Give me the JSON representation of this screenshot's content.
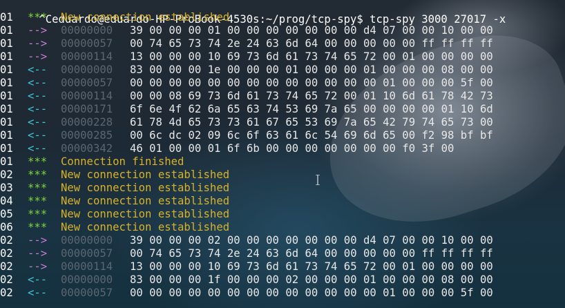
{
  "prompt": "^Ceduardo@eduardo-HP-ProBook-4530s:~/prog/tcp-spy$ tcp-spy 3000 27017 -x",
  "colors": {
    "info_marker": "#7fd63c",
    "outgoing_marker": "#c77bd0",
    "incoming_marker": "#3ec6d4",
    "status_message": "#d8b22a",
    "offset": "#5b6670",
    "hex": "#e8e8e8"
  },
  "lines": [
    {
      "cid": "01",
      "marker": "***",
      "kind": "info",
      "text": "New connection established"
    },
    {
      "cid": "01",
      "marker": "-->",
      "kind": "out",
      "offset": "00000000",
      "hex": "39 00 00 00 01 00 00 00 00 00 00 00 d4 07 00 00 10 00 00"
    },
    {
      "cid": "01",
      "marker": "-->",
      "kind": "out",
      "offset": "00000057",
      "hex": "00 74 65 73 74 2e 24 63 6d 64 00 00 00 00 00 ff ff ff ff"
    },
    {
      "cid": "01",
      "marker": "-->",
      "kind": "out",
      "offset": "00000114",
      "hex": "13 00 00 00 10 69 73 6d 61 73 74 65 72 00 01 00 00 00 00"
    },
    {
      "cid": "01",
      "marker": "<--",
      "kind": "in",
      "offset": "00000000",
      "hex": "83 00 00 00 1e 00 00 00 01 00 00 00 01 00 00 00 08 00 00"
    },
    {
      "cid": "01",
      "marker": "<--",
      "kind": "in",
      "offset": "00000057",
      "hex": "00 00 00 00 00 00 00 00 00 00 00 00 00 01 00 00 00 5f 00"
    },
    {
      "cid": "01",
      "marker": "<--",
      "kind": "in",
      "offset": "00000114",
      "hex": "00 00 08 69 73 6d 61 73 74 65 72 00 01 10 6d 61 78 42 73"
    },
    {
      "cid": "01",
      "marker": "<--",
      "kind": "in",
      "offset": "00000171",
      "hex": "6f 6e 4f 62 6a 65 63 74 53 69 7a 65 00 00 00 00 01 10 6d"
    },
    {
      "cid": "01",
      "marker": "<--",
      "kind": "in",
      "offset": "00000228",
      "hex": "61 78 4d 65 73 73 61 67 65 53 69 7a 65 42 79 74 65 73 00"
    },
    {
      "cid": "01",
      "marker": "<--",
      "kind": "in",
      "offset": "00000285",
      "hex": "00 6c dc 02 09 6c 6f 63 61 6c 54 69 6d 65 00 f2 98 bf bf"
    },
    {
      "cid": "01",
      "marker": "<--",
      "kind": "in",
      "offset": "00000342",
      "hex": "46 01 00 00 01 6f 6b 00 00 00 00 00 00 00 f0 3f 00"
    },
    {
      "cid": "01",
      "marker": "***",
      "kind": "info",
      "text": "Connection finished"
    },
    {
      "cid": "02",
      "marker": "***",
      "kind": "info",
      "text": "New connection established"
    },
    {
      "cid": "03",
      "marker": "***",
      "kind": "info",
      "text": "New connection established"
    },
    {
      "cid": "04",
      "marker": "***",
      "kind": "info",
      "text": "New connection established"
    },
    {
      "cid": "05",
      "marker": "***",
      "kind": "info",
      "text": "New connection established"
    },
    {
      "cid": "06",
      "marker": "***",
      "kind": "info",
      "text": "New connection established"
    },
    {
      "cid": "02",
      "marker": "-->",
      "kind": "out",
      "offset": "00000000",
      "hex": "39 00 00 00 02 00 00 00 00 00 00 00 d4 07 00 00 10 00 00"
    },
    {
      "cid": "02",
      "marker": "-->",
      "kind": "out",
      "offset": "00000057",
      "hex": "00 74 65 73 74 2e 24 63 6d 64 00 00 00 00 00 ff ff ff ff"
    },
    {
      "cid": "02",
      "marker": "-->",
      "kind": "out",
      "offset": "00000114",
      "hex": "13 00 00 00 10 69 73 6d 61 73 74 65 72 00 01 00 00 00 00"
    },
    {
      "cid": "02",
      "marker": "<--",
      "kind": "in",
      "offset": "00000000",
      "hex": "83 00 00 00 1f 00 00 00 02 00 00 00 01 00 00 00 08 00 00"
    },
    {
      "cid": "02",
      "marker": "<--",
      "kind": "in",
      "offset": "00000057",
      "hex": "00 00 00 00 00 00 00 00 00 00 00 00 00 01 00 00 00 5f 00"
    }
  ]
}
